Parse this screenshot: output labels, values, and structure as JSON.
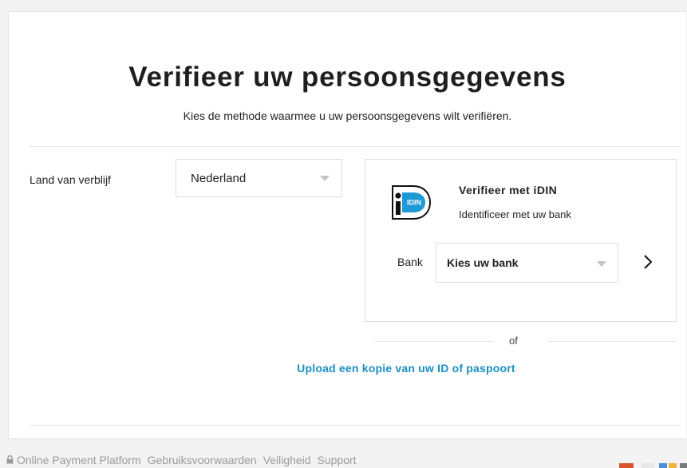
{
  "header": {
    "title": "Verifieer uw persoonsgegevens",
    "subtitle": "Kies de methode waarmee u uw persoonsgegevens wilt verifiëren."
  },
  "country": {
    "label": "Land van verblijf",
    "selected": "Nederland"
  },
  "idin": {
    "logo_text": "IDIN",
    "title": "Verifieer met iDIN",
    "description": "Identificeer met uw bank",
    "bank_label": "Bank",
    "bank_selected": "Kies uw bank"
  },
  "alternative": {
    "or_text": "of",
    "upload_link": "Upload een kopie van uw ID of paspoort"
  },
  "footer": {
    "brand": "Online Payment Platform",
    "links": [
      "Gebruiksvoorwaarden",
      "Veiligheid",
      "Support"
    ]
  },
  "colors": {
    "link": "#1a8fc4",
    "text": "#1f1f1f",
    "footer_text": "#9a9a9a"
  },
  "icons": {
    "idin_logo": "idin-logo-icon",
    "dropdown": "caret-down-icon",
    "next": "chevron-right-icon",
    "lock": "lock-icon"
  }
}
